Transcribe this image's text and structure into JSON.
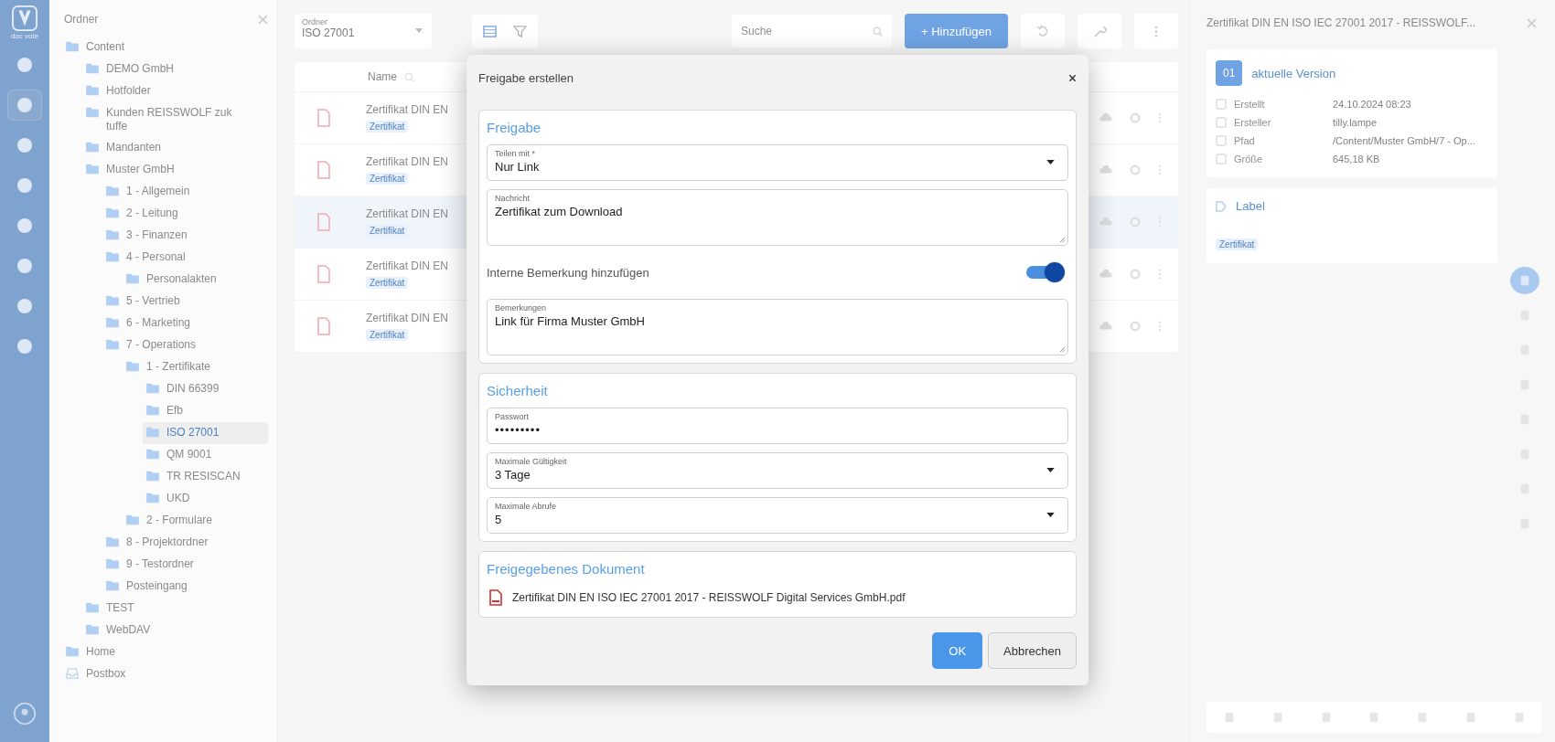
{
  "rail": {
    "logo_text": "doc vote",
    "items": [
      {
        "selected": false
      },
      {
        "selected": true
      },
      {
        "selected": false
      },
      {
        "selected": false
      },
      {
        "selected": false
      },
      {
        "selected": false
      },
      {
        "selected": false
      },
      {
        "selected": false
      }
    ]
  },
  "tree": {
    "title": "Ordner",
    "items": [
      {
        "label": "Content",
        "kind": "root",
        "selected": false,
        "children": [
          {
            "label": "DEMO GmbH",
            "selected": false
          },
          {
            "label": "Hotfolder",
            "selected": false
          },
          {
            "label": "Kunden REISSWOLF zuk tuffe",
            "selected": false
          },
          {
            "label": "Mandanten",
            "selected": false
          },
          {
            "label": "Muster GmbH",
            "selected": false,
            "children": [
              {
                "label": "1 - Allgemein",
                "selected": false
              },
              {
                "label": "2 - Leitung",
                "selected": false
              },
              {
                "label": "3 - Finanzen",
                "selected": false
              },
              {
                "label": "4 - Personal",
                "selected": false,
                "children": [
                  {
                    "label": "Personalakten",
                    "selected": false
                  }
                ]
              },
              {
                "label": "5 - Vertrieb",
                "selected": false
              },
              {
                "label": "6 - Marketing",
                "selected": false
              },
              {
                "label": "7 - Operations",
                "selected": false,
                "children": [
                  {
                    "label": "1 - Zertifikate",
                    "selected": false,
                    "children": [
                      {
                        "label": "DIN 66399",
                        "selected": false
                      },
                      {
                        "label": "Efb",
                        "selected": false
                      },
                      {
                        "label": "ISO 27001",
                        "selected": true
                      },
                      {
                        "label": "QM 9001",
                        "selected": false
                      },
                      {
                        "label": "TR RESISCAN",
                        "selected": false
                      },
                      {
                        "label": "UKD",
                        "selected": false
                      }
                    ]
                  },
                  {
                    "label": "2 - Formulare",
                    "selected": false
                  }
                ]
              },
              {
                "label": "8 - Projektordner",
                "selected": false
              },
              {
                "label": "9 - Testordner",
                "selected": false
              },
              {
                "label": "Posteingang",
                "selected": false
              }
            ]
          },
          {
            "label": "TEST",
            "selected": false
          },
          {
            "label": "WebDAV",
            "selected": false
          }
        ]
      },
      {
        "label": "Home",
        "kind": "root",
        "selected": false
      },
      {
        "label": "Postbox",
        "kind": "inbox",
        "selected": false
      }
    ]
  },
  "toolbar": {
    "views": [
      {
        "selected": true
      },
      {
        "selected": false
      }
    ],
    "folder_label": "Ordner",
    "folder_value": "ISO 27001",
    "search_placeholder": "Suche",
    "add_button": "+ Hinzufügen"
  },
  "table": {
    "name_column": "Name",
    "rows": [
      {
        "name": "Zertifikat DIN EN",
        "tag": "Zertifikat",
        "selected": false
      },
      {
        "name": "Zertifikat DIN EN",
        "tag": "Zertifikat",
        "selected": false
      },
      {
        "name": "Zertifikat DIN EN",
        "tag": "Zertifikat",
        "selected": true
      },
      {
        "name": "Zertifikat DIN EN",
        "tag": "Zertifikat",
        "selected": false
      },
      {
        "name": "Zertifikat DIN EN",
        "tag": "Zertifikat",
        "selected": false
      }
    ]
  },
  "details": {
    "title": "Zertifikat DIN EN ISO IEC 27001 2017 - REISSWOLF...",
    "version_badge": "01",
    "version_label": "aktuelle Version",
    "properties": [
      {
        "label": "Erstellt",
        "value": "24.10.2024 08:23"
      },
      {
        "label": "Ersteller",
        "value": "tilly.lampe"
      },
      {
        "label": "Pfad",
        "value": "/Content/Muster GmbH/7 - Op..."
      },
      {
        "label": "Größe",
        "value": "645,18 KB"
      }
    ],
    "label_title": "Label",
    "label_tag": "Zertifikat",
    "side_icons": [
      {
        "selected": true
      },
      {
        "selected": false
      },
      {
        "selected": false
      },
      {
        "selected": false
      },
      {
        "selected": false
      },
      {
        "selected": false
      },
      {
        "selected": false
      },
      {
        "selected": false
      }
    ]
  },
  "dialog": {
    "title": "Freigabe erstellen",
    "share": {
      "heading": "Freigabe",
      "share_with": {
        "label": "Teilen mit *",
        "value": "Nur Link"
      },
      "message": {
        "label": "Nachricht",
        "value": "Zertifikat zum Download"
      },
      "internal_note": {
        "label": "Interne Bemerkung hinzufügen",
        "on": true
      },
      "remarks": {
        "label": "Bemerkungen",
        "value": "Link für Firma Muster GmbH"
      }
    },
    "security": {
      "heading": "Sicherheit",
      "password": {
        "label": "Passwort",
        "value": "•••••••••"
      },
      "validity": {
        "label": "Maximale Gültigkeit",
        "value": "3 Tage"
      },
      "max_downloads": {
        "label": "Maximale Abrufe",
        "value": "5"
      }
    },
    "document": {
      "heading": "Freigegebenes Dokument",
      "file_name": "Zertifikat DIN EN ISO IEC 27001 2017 - REISSWOLF Digital Services GmbH.pdf"
    },
    "ok_button": "OK",
    "cancel_button": "Abbrechen"
  }
}
